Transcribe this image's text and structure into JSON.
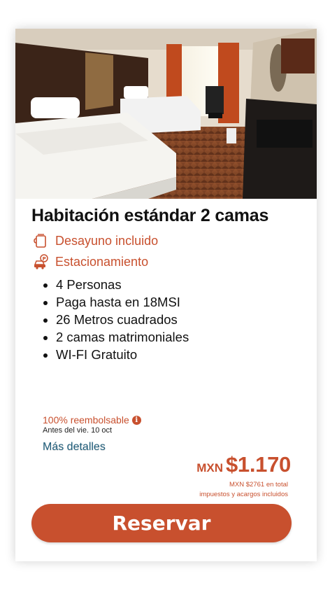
{
  "room": {
    "title": "Habitación estándar 2 camas",
    "photo_icon": "hotel-room-photo",
    "amenities": [
      {
        "icon": "coffee-mug-icon",
        "label": "Desayuno incluido"
      },
      {
        "icon": "car-parking-icon",
        "label": "Estacionamiento"
      }
    ],
    "features": [
      "4 Personas",
      "Paga hasta en 18MSI",
      "26 Metros cuadrados",
      "2 camas matrimoniales",
      "WI-FI Gratuito"
    ]
  },
  "policy": {
    "refund": "100% reembolsable",
    "info_icon": "info-icon",
    "deadline": "Antes del vie. 10 oct",
    "details_link": "Más detalles"
  },
  "pricing": {
    "currency": "MXN",
    "amount": "$1.170",
    "total_line1": "MXN $2761 en total",
    "total_line2": "impuestos y acargos incluidos"
  },
  "cta": {
    "label": "Reservar"
  },
  "colors": {
    "accent": "#c8502e",
    "link": "#1f5d7a",
    "text": "#111111"
  }
}
